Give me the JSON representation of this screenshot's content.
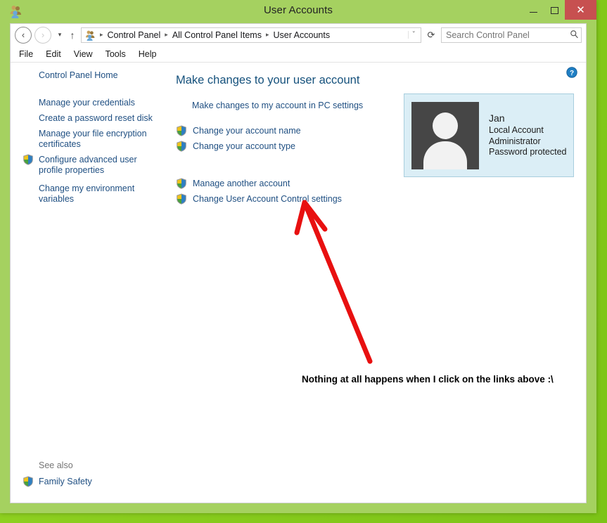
{
  "window": {
    "title": "User Accounts",
    "icon": "user-accounts-icon",
    "controls": {
      "minimize": "–",
      "maximize": "□",
      "close": "✕"
    },
    "chrome_color": "#a5d160",
    "close_color": "#c75050"
  },
  "navbar": {
    "back": "‹",
    "forward": "›",
    "recent_dropdown": "▾",
    "up": "↑",
    "address_icon": "user-accounts-icon",
    "breadcrumbs": [
      "Control Panel",
      "All Control Panel Items",
      "User Accounts"
    ],
    "breadcrumb_separator": "▸",
    "address_dropdown": "ˇ",
    "refresh": "⟳",
    "search": {
      "placeholder": "Search Control Panel",
      "value": "",
      "icon": "search-icon"
    }
  },
  "menubar": {
    "items": [
      "File",
      "Edit",
      "View",
      "Tools",
      "Help"
    ]
  },
  "sidebar": {
    "home_label": "Control Panel Home",
    "items": [
      {
        "label": "Manage your credentials",
        "shield": false
      },
      {
        "label": "Create a password reset disk",
        "shield": false
      },
      {
        "label": "Manage your file encryption certificates",
        "shield": false
      },
      {
        "label": "Configure advanced user profile properties",
        "shield": true
      },
      {
        "label": "Change my environment variables",
        "shield": false
      }
    ],
    "see_also_label": "See also",
    "see_also_items": [
      {
        "label": "Family Safety",
        "shield": true
      }
    ]
  },
  "content": {
    "help_icon": "help-icon",
    "heading": "Make changes to your user account",
    "pc_settings_link": "Make changes to my account in PC settings",
    "links_group_1": [
      {
        "label": "Change your account name",
        "shield": true
      },
      {
        "label": "Change your account type",
        "shield": true
      }
    ],
    "links_group_2": [
      {
        "label": "Manage another account",
        "shield": true
      },
      {
        "label": "Change User Account Control settings",
        "shield": true
      }
    ],
    "account": {
      "avatar": "default-user-avatar",
      "name": "Jan",
      "details": [
        "Local Account",
        "Administrator",
        "Password protected"
      ]
    }
  },
  "annotation": {
    "text": "Nothing at all happens when I click on the links above :\\",
    "arrow_color": "#e81010",
    "arrow_name": "red-annotation-arrow"
  },
  "colors": {
    "link": "#1f4f82",
    "heading": "#15517c",
    "card_bg": "#dbeef6",
    "card_border": "#a8cede",
    "avatar_bg": "#464646"
  }
}
